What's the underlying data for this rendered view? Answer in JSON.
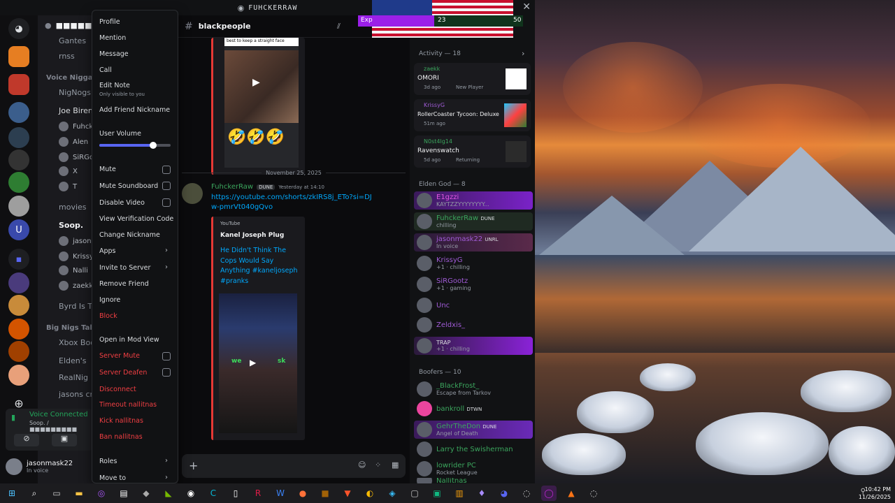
{
  "window": {
    "title": "FUHCKERRAW",
    "close_icon": "close-icon"
  },
  "overlay": {
    "exp_label": "Exp",
    "exp_value": "23",
    "exp_max": "50",
    "exp_fraction": 0.46
  },
  "channel_list": {
    "server_name": "■■■■■",
    "top_channels": [
      "Gantes",
      "rnss"
    ],
    "voice_category": "Voice Niggas T",
    "channels": [
      "NigNogs",
      "Joe Biren"
    ],
    "voice_users": [
      "Fuhck",
      "Alen",
      "SiRGo",
      "X",
      "T"
    ],
    "movies": "movies",
    "soop": "Soop.",
    "soop_users": [
      "jason",
      "Krissy",
      "Nalli",
      "zaekk"
    ],
    "byrd": "Byrd Is Th",
    "category2": "Big Nigs Talk",
    "channels2": [
      "Xbox Boo",
      "Elden's",
      "RealNig",
      "jasons cri"
    ],
    "voice_connected": "Voice Connected",
    "voice_sub": "Soop. / ■■■■■■■■■",
    "username": "jasonmask22",
    "user_status": "In voice"
  },
  "context_menu": {
    "items": [
      "Profile",
      "Mention",
      "Message",
      "Call",
      "Edit Note",
      "Add Friend Nickname",
      "User Volume",
      "Mute",
      "Mute Soundboard",
      "Disable Video",
      "View Verification Code",
      "Change Nickname",
      "Apps",
      "Invite to Server",
      "Remove Friend",
      "Ignore",
      "Block",
      "Open in Mod View",
      "Server Mute",
      "Server Deafen",
      "Disconnect",
      "Timeout nallitnas",
      "Kick nallitnas",
      "Ban nallitnas",
      "Roles",
      "Move to"
    ],
    "edit_note_sub": "Only visible to you",
    "user_volume_fraction": 0.75
  },
  "chat": {
    "channel_name": "blackpeople",
    "date_divider": "November 25, 2025",
    "author": "FuhckerRaw",
    "author_tag": "DUNE",
    "timestamp": "Yesterday at 14:10",
    "link": "https://youtube.com/shorts/zkIRS8j_ETo?si=DJw-pmrVt040gQvo",
    "embed_provider": "YouTube",
    "embed_author": "Kanel Joseph Plug",
    "embed_title": "He Didn't Think The Cops Would Say Anything #kaneljoseph #pranks",
    "top_caption": "best to keep a straight face",
    "emoji_row": "🤣🤣🤣",
    "video_overlay": "we",
    "video_overlay2": "sk"
  },
  "members": {
    "activity_header": "Activity — 18",
    "activities": [
      {
        "name": "zaekk",
        "game": "OMORI",
        "meta": "3d ago",
        "meta2": "New Player"
      },
      {
        "name": "KrissyG",
        "game": "RollerCoaster Tycoon: Deluxe",
        "meta": "51m ago",
        "meta2": ""
      },
      {
        "name": "N0st4lg14",
        "game": "Ravenswatch",
        "meta": "5d ago",
        "meta2": "Returning"
      }
    ],
    "elden_header": "Elden God — 8",
    "elden": [
      {
        "name": "E1gzzi",
        "status": "KAYTZZYYYYYYYY...",
        "tag": ""
      },
      {
        "name": "FuhckerRaw",
        "status": "chilling",
        "tag": "DUNE"
      },
      {
        "name": "jasonmask22",
        "status": "In voice",
        "tag": "UNRL"
      },
      {
        "name": "KrissyG",
        "status": "+1 · chilling",
        "tag": ""
      },
      {
        "name": "SiRGootz",
        "status": "+1 · gaming",
        "tag": ""
      },
      {
        "name": "Unc",
        "status": "",
        "tag": ""
      },
      {
        "name": "Zeldxis_",
        "status": "",
        "tag": ""
      },
      {
        "name": "",
        "status": "+1 · chilling",
        "tag": "TRAP"
      }
    ],
    "boofers_header": "Boofers — 10",
    "boofers": [
      {
        "name": "_BlackFrost_",
        "status": "Escape from Tarkov",
        "tag": ""
      },
      {
        "name": "bankroll",
        "status": "",
        "tag": "DTWN"
      },
      {
        "name": "GehrTheDon",
        "status": "Angel of Death",
        "tag": "DUNE"
      },
      {
        "name": "Larry the Swisherman",
        "status": "",
        "tag": ""
      },
      {
        "name": "lowrider PC",
        "status": "Rocket League",
        "tag": ""
      },
      {
        "name": "Nallitnas",
        "status": "",
        "tag": ""
      }
    ]
  },
  "taskbar": {
    "time": "10:42 PM",
    "date": "11/26/2025"
  },
  "colors": {
    "accent": "#5865f2",
    "danger": "#f23f43",
    "online": "#23a55a",
    "purple_name": "#a05bd6",
    "green_name": "#3ba55d"
  }
}
